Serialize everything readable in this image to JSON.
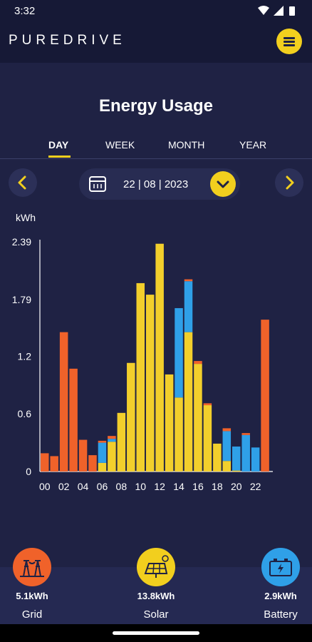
{
  "status": {
    "time": "3:32"
  },
  "header": {
    "logo": "PUREDRIVE"
  },
  "page": {
    "title": "Energy Usage"
  },
  "tabs": [
    {
      "label": "DAY",
      "active": true
    },
    {
      "label": "WEEK",
      "active": false
    },
    {
      "label": "MONTH",
      "active": false
    },
    {
      "label": "YEAR",
      "active": false
    }
  ],
  "date_picker": {
    "value": "22 | 08 | 2023"
  },
  "colors": {
    "grid": "#f0622a",
    "solar": "#f2cf2c",
    "battery": "#2fa0e8",
    "accent": "#f2cf1e",
    "background": "#1f2244"
  },
  "chart_data": {
    "type": "bar",
    "stacked": true,
    "ylabel": "kWh",
    "ylim": [
      0,
      2.39
    ],
    "y_ticks": [
      "0",
      "0.6",
      "1.2",
      "1.79",
      "2.39"
    ],
    "x_ticks": [
      "00",
      "02",
      "04",
      "06",
      "08",
      "10",
      "12",
      "14",
      "16",
      "18",
      "20",
      "22"
    ],
    "hours": [
      0,
      1,
      2,
      3,
      4,
      5,
      6,
      7,
      8,
      9,
      10,
      11,
      12,
      13,
      14,
      15,
      16,
      17,
      18,
      19,
      20,
      21,
      22,
      23
    ],
    "series": [
      {
        "name": "Grid",
        "color": "#f0622a",
        "values": [
          0.19,
          0.16,
          1.45,
          1.07,
          0.33,
          0.17,
          0.02,
          0.03,
          0,
          0,
          0,
          0,
          0,
          0,
          0,
          0.02,
          0.03,
          0.02,
          0,
          0.03,
          0,
          0.02,
          0,
          1.58
        ]
      },
      {
        "name": "Solar",
        "color": "#f2cf2c",
        "values": [
          0,
          0,
          0,
          0,
          0,
          0,
          0.09,
          0.31,
          0.61,
          1.13,
          1.96,
          1.84,
          2.37,
          1.01,
          0.77,
          1.45,
          1.12,
          0.69,
          0.29,
          0.11,
          0.01,
          0,
          0,
          0
        ]
      },
      {
        "name": "Battery",
        "color": "#2fa0e8",
        "values": [
          0,
          0,
          0,
          0,
          0,
          0,
          0.21,
          0.03,
          0,
          0,
          0,
          0,
          0,
          0,
          0.93,
          0.53,
          0,
          0,
          0,
          0.31,
          0.25,
          0.38,
          0.25,
          0
        ]
      }
    ]
  },
  "sources": [
    {
      "key": "grid",
      "value": "5.1kWh",
      "label": "Grid",
      "icon": "power-tower-icon",
      "color": "#f0622a"
    },
    {
      "key": "solar",
      "value": "13.8kWh",
      "label": "Solar",
      "icon": "solar-panel-icon",
      "color": "#f2cf1e"
    },
    {
      "key": "battery",
      "value": "2.9kWh",
      "label": "Battery",
      "icon": "battery-icon",
      "color": "#2fa0e8"
    }
  ]
}
